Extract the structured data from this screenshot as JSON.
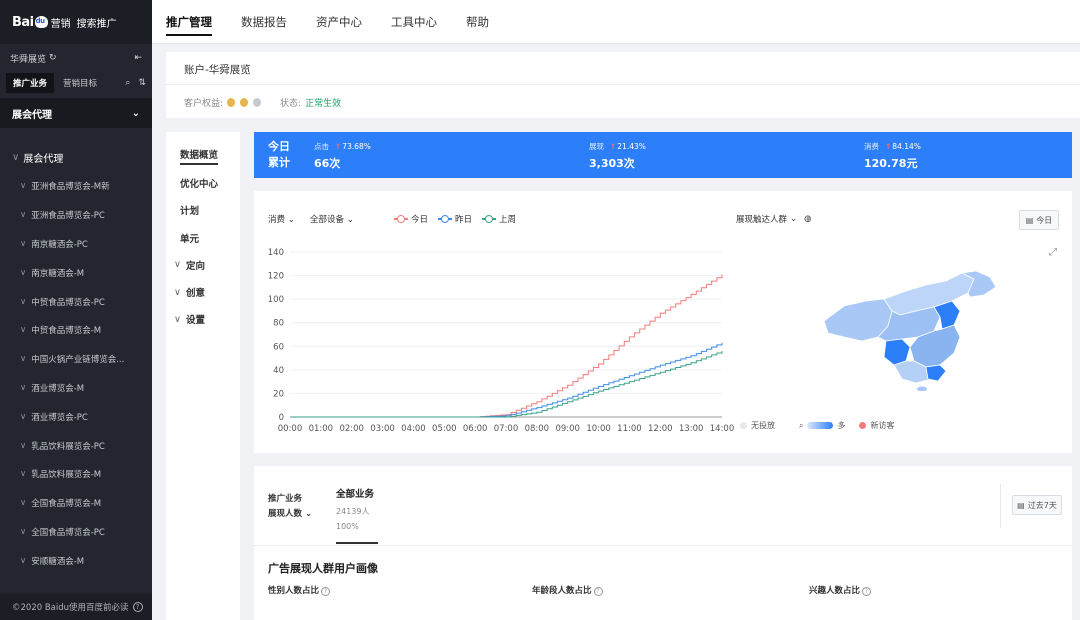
{
  "brand": {
    "logo_text": "Bai",
    "logo_sub": "营销",
    "product": "搜索推广"
  },
  "sidebar": {
    "account": "华舜展览",
    "tabs": [
      "推广业务",
      "营销目标"
    ],
    "group": "展会代理",
    "plan_header": "展会代理",
    "plans": [
      "亚洲食品博览会-M新",
      "亚洲食品博览会-PC",
      "南京糖酒会-PC",
      "南京糖酒会-M",
      "中贸食品博览会-PC",
      "中贸食品博览会-M",
      "中国火锅产业链博览会...",
      "酒业博览会-M",
      "酒业博览会-PC",
      "乳品饮料展览会-PC",
      "乳品饮料展览会-M",
      "全国食品博览会-M",
      "全国食品博览会-PC",
      "安顺糖酒会-M"
    ],
    "footer": "©2020 Baidu使用百度前必读"
  },
  "topnav": [
    "推广管理",
    "数据报告",
    "资产中心",
    "工具中心",
    "帮助"
  ],
  "account_header": {
    "name": "账户-华舜展览",
    "rights_label": "客户权益:",
    "status_label": "状态:",
    "status_value": "正常生效"
  },
  "subnav": [
    "数据概览",
    "优化中心",
    "计划",
    "单元",
    "定向",
    "创意",
    "设置"
  ],
  "stats": {
    "today_line1": "今日",
    "today_line2": "累计",
    "metrics": [
      {
        "label": "点击",
        "change": "73.68%",
        "value": "66次"
      },
      {
        "label": "展现",
        "change": "21.43%",
        "value": "3,303次"
      },
      {
        "label": "消费",
        "change": "84.14%",
        "value": "120.78元"
      }
    ]
  },
  "chart_controls": {
    "metric": "消费",
    "device": "全部设备",
    "crowd": "展现触达人群",
    "today_button": "今日"
  },
  "map_legend": {
    "none": "无投放",
    "more": "多",
    "new_visitor": "新访客"
  },
  "colors": {
    "today": "#f07c7c",
    "yesterday": "#3f8bea",
    "last_week": "#3aa08a",
    "primary": "#2d7ff9",
    "sidebar": "#23262e"
  },
  "chart_data": {
    "type": "line",
    "x": [
      "00:00",
      "01:00",
      "02:00",
      "03:00",
      "04:00",
      "05:00",
      "06:00",
      "07:00",
      "08:00",
      "09:00",
      "10:00",
      "11:00",
      "12:00",
      "13:00",
      "14:00"
    ],
    "ylim": [
      0,
      140
    ],
    "yticks": [
      0,
      20,
      40,
      60,
      80,
      100,
      120,
      140
    ],
    "series": [
      {
        "name": "今日",
        "values": [
          0,
          0,
          0,
          0,
          0,
          0,
          0,
          2,
          13,
          27,
          45,
          68,
          88,
          104,
          121
        ]
      },
      {
        "name": "昨日",
        "values": [
          0,
          0,
          0,
          0,
          0,
          0,
          0,
          1,
          8,
          16,
          26,
          35,
          44,
          52,
          63
        ]
      },
      {
        "name": "上周",
        "values": [
          0,
          0,
          0,
          0,
          0,
          0,
          0,
          0,
          4,
          13,
          22,
          30,
          38,
          46,
          56
        ]
      }
    ]
  },
  "bottom": {
    "biz_label": "推广业务",
    "reach_label": "展现人数",
    "all_biz": "全部业务",
    "count": "24139人",
    "percent": "100%",
    "past_button": "过去7天",
    "section_title": "广告展现人群用户画像",
    "sub_gender": "性别人数占比",
    "sub_age": "年龄段人数占比",
    "sub_interest": "兴趣人数占比"
  }
}
